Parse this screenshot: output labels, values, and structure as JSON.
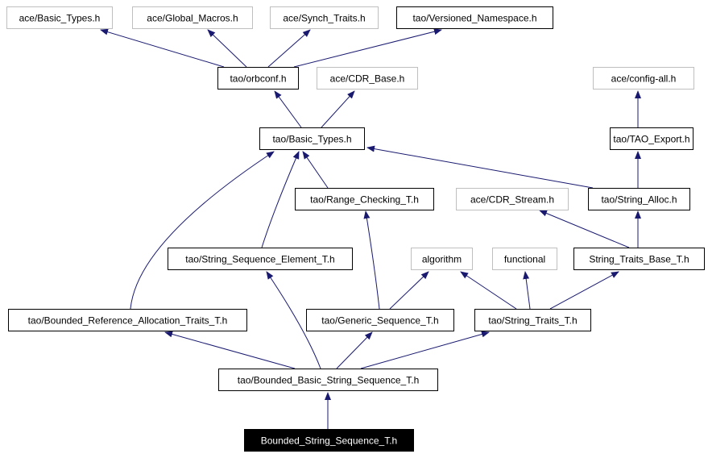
{
  "diagram": {
    "type": "include-dependency-graph",
    "colors": {
      "edge": "#191970",
      "node_border_documented": "#000000",
      "node_border_external": "#bfbfbf",
      "node_fill": "#ffffff",
      "root_fill": "#000000",
      "root_text": "#ffffff",
      "text": "#000000"
    },
    "nodes": [
      {
        "id": "ace_basic_types",
        "label": "ace/Basic_Types.h",
        "style": "external"
      },
      {
        "id": "ace_global_macros",
        "label": "ace/Global_Macros.h",
        "style": "external"
      },
      {
        "id": "ace_synch_traits",
        "label": "ace/Synch_Traits.h",
        "style": "external"
      },
      {
        "id": "tao_versioned_namespace",
        "label": "tao/Versioned_Namespace.h",
        "style": "documented"
      },
      {
        "id": "tao_orbconf",
        "label": "tao/orbconf.h",
        "style": "documented"
      },
      {
        "id": "ace_cdr_base",
        "label": "ace/CDR_Base.h",
        "style": "external"
      },
      {
        "id": "ace_config_all",
        "label": "ace/config-all.h",
        "style": "external"
      },
      {
        "id": "tao_basic_types",
        "label": "tao/Basic_Types.h",
        "style": "documented"
      },
      {
        "id": "tao_tao_export",
        "label": "tao/TAO_Export.h",
        "style": "documented"
      },
      {
        "id": "tao_range_checking",
        "label": "tao/Range_Checking_T.h",
        "style": "documented"
      },
      {
        "id": "ace_cdr_stream",
        "label": "ace/CDR_Stream.h",
        "style": "external"
      },
      {
        "id": "tao_string_alloc",
        "label": "tao/String_Alloc.h",
        "style": "documented"
      },
      {
        "id": "tao_string_sequence_element",
        "label": "tao/String_Sequence_Element_T.h",
        "style": "documented"
      },
      {
        "id": "algorithm",
        "label": "algorithm",
        "style": "external"
      },
      {
        "id": "functional",
        "label": "functional",
        "style": "external"
      },
      {
        "id": "string_traits_base",
        "label": "String_Traits_Base_T.h",
        "style": "documented"
      },
      {
        "id": "tao_bounded_reference_allocation_traits",
        "label": "tao/Bounded_Reference_Allocation_Traits_T.h",
        "style": "documented"
      },
      {
        "id": "tao_generic_sequence",
        "label": "tao/Generic_Sequence_T.h",
        "style": "documented"
      },
      {
        "id": "tao_string_traits",
        "label": "tao/String_Traits_T.h",
        "style": "documented"
      },
      {
        "id": "tao_bounded_basic_string_sequence",
        "label": "tao/Bounded_Basic_String_Sequence_T.h",
        "style": "documented"
      },
      {
        "id": "bounded_string_sequence",
        "label": "Bounded_String_Sequence_T.h",
        "style": "root"
      }
    ],
    "edges": [
      {
        "from": "tao_orbconf",
        "to": "ace_basic_types"
      },
      {
        "from": "tao_orbconf",
        "to": "ace_global_macros"
      },
      {
        "from": "tao_orbconf",
        "to": "ace_synch_traits"
      },
      {
        "from": "tao_orbconf",
        "to": "tao_versioned_namespace"
      },
      {
        "from": "tao_basic_types",
        "to": "tao_orbconf"
      },
      {
        "from": "tao_basic_types",
        "to": "ace_cdr_base"
      },
      {
        "from": "tao_tao_export",
        "to": "ace_config_all"
      },
      {
        "from": "tao_string_alloc",
        "to": "tao_tao_export"
      },
      {
        "from": "tao_string_alloc",
        "to": "tao_basic_types"
      },
      {
        "from": "tao_range_checking",
        "to": "tao_basic_types"
      },
      {
        "from": "tao_string_sequence_element",
        "to": "tao_basic_types"
      },
      {
        "from": "tao_bounded_reference_allocation_traits",
        "to": "tao_basic_types"
      },
      {
        "from": "string_traits_base",
        "to": "ace_cdr_stream"
      },
      {
        "from": "string_traits_base",
        "to": "tao_string_alloc"
      },
      {
        "from": "tao_generic_sequence",
        "to": "tao_range_checking"
      },
      {
        "from": "tao_generic_sequence",
        "to": "algorithm"
      },
      {
        "from": "tao_string_traits",
        "to": "algorithm"
      },
      {
        "from": "tao_string_traits",
        "to": "functional"
      },
      {
        "from": "tao_string_traits",
        "to": "string_traits_base"
      },
      {
        "from": "tao_bounded_basic_string_sequence",
        "to": "tao_bounded_reference_allocation_traits"
      },
      {
        "from": "tao_bounded_basic_string_sequence",
        "to": "tao_string_sequence_element"
      },
      {
        "from": "tao_bounded_basic_string_sequence",
        "to": "tao_generic_sequence"
      },
      {
        "from": "tao_bounded_basic_string_sequence",
        "to": "tao_string_traits"
      },
      {
        "from": "bounded_string_sequence",
        "to": "tao_bounded_basic_string_sequence"
      }
    ]
  }
}
